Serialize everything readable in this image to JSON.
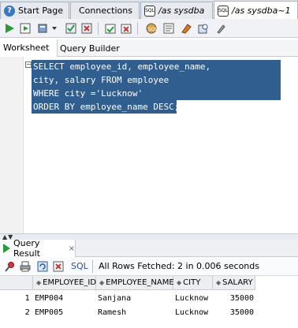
{
  "tabs": [
    {
      "label": "Start Page",
      "icon": "help-icon"
    },
    {
      "label": "Connections",
      "icon": "none"
    },
    {
      "label": "/as sysdba",
      "icon": "sql-db-icon"
    },
    {
      "label": "/as sysdba~1",
      "icon": "sql-db-icon"
    }
  ],
  "subtabs": {
    "worksheet": "Worksheet",
    "query_builder": "Query Builder"
  },
  "editor": {
    "lines": [
      "SELECT employee_id, employee_name,",
      "city, salary FROM employee",
      "WHERE city ='Lucknow'",
      "ORDER BY employee_name DESC;"
    ],
    "selection_color": "#2f5e8f"
  },
  "result": {
    "tab_label": "Query Result",
    "sql_label": "SQL",
    "status": "All Rows Fetched: 2 in 0.006 seconds",
    "columns": [
      "EMPLOYEE_ID",
      "EMPLOYEE_NAME",
      "CITY",
      "SALARY"
    ],
    "rows": [
      {
        "num": "1",
        "cells": [
          "EMP004",
          "Sanjana",
          "Lucknow",
          "35000"
        ]
      },
      {
        "num": "2",
        "cells": [
          "EMP005",
          "Ramesh",
          "Lucknow",
          "35000"
        ]
      }
    ]
  }
}
